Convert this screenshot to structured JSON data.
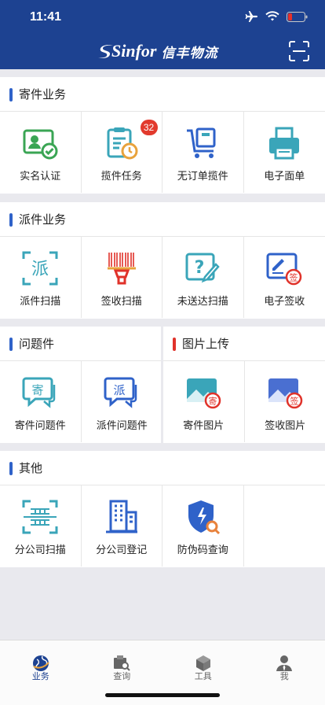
{
  "status": {
    "time": "11:41"
  },
  "header": {
    "logo_en": "Sinfor",
    "logo_cn": "信丰物流"
  },
  "sections": {
    "send": {
      "title": "寄件业务",
      "items": [
        {
          "label": "实名认证",
          "icon": "id-card-check-icon"
        },
        {
          "label": "揽件任务",
          "icon": "clipboard-clock-icon",
          "badge": "32"
        },
        {
          "label": "无订单揽件",
          "icon": "cart-box-icon"
        },
        {
          "label": "电子面单",
          "icon": "printer-icon"
        }
      ]
    },
    "dispatch": {
      "title": "派件业务",
      "items": [
        {
          "label": "派件扫描",
          "icon": "dispatch-scan-icon",
          "glyph": "派"
        },
        {
          "label": "签收扫描",
          "icon": "barcode-scanner-icon"
        },
        {
          "label": "未送达扫描",
          "icon": "question-edit-icon"
        },
        {
          "label": "电子签收",
          "icon": "e-sign-icon",
          "glyph": "签"
        }
      ]
    },
    "problem": {
      "title": "问题件",
      "items": [
        {
          "label": "寄件问题件",
          "icon": "send-issue-chat-icon",
          "glyph": "寄"
        },
        {
          "label": "派件问题件",
          "icon": "dispatch-issue-chat-icon",
          "glyph": "派"
        }
      ]
    },
    "photo": {
      "title": "图片上传",
      "items": [
        {
          "label": "寄件图片",
          "icon": "send-photo-icon",
          "glyph": "寄"
        },
        {
          "label": "签收图片",
          "icon": "sign-photo-icon",
          "glyph": "签"
        }
      ]
    },
    "other": {
      "title": "其他",
      "items": [
        {
          "label": "分公司扫描",
          "icon": "branch-scan-icon"
        },
        {
          "label": "分公司登记",
          "icon": "building-icon"
        },
        {
          "label": "防伪码查询",
          "icon": "shield-search-icon"
        }
      ]
    }
  },
  "tabbar": [
    {
      "label": "业务",
      "icon": "globe-icon",
      "active": true
    },
    {
      "label": "查询",
      "icon": "search-box-icon"
    },
    {
      "label": "工具",
      "icon": "cube-icon"
    },
    {
      "label": "我",
      "icon": "person-icon"
    }
  ],
  "colors": {
    "header": "#1d4291",
    "accent_blue": "#2f62c9",
    "accent_red": "#e0322a",
    "teal": "#3aa5b9",
    "badge": "#e23a2d"
  }
}
